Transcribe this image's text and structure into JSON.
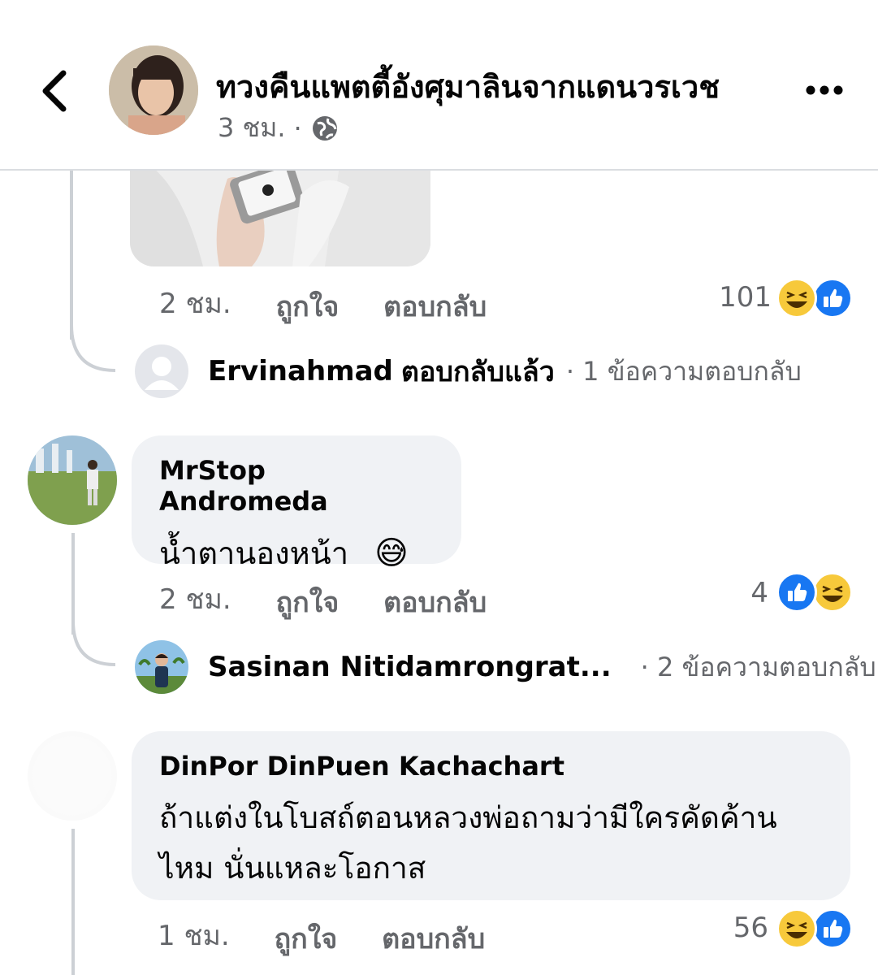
{
  "header": {
    "page_name": "ทวงคืนแพตตี้อังศุมาลินจากแดนวรเวช",
    "time": "3 ชม.",
    "dot": "·"
  },
  "comments": [
    {
      "time": "2 ชม.",
      "like_label": "ถูกใจ",
      "reply_label": "ตอบกลับ",
      "reaction_count": "101",
      "reactions": [
        "haha",
        "like"
      ]
    },
    {
      "author": "MrStop Andromeda",
      "text": "น้ำตานองหน้า",
      "emoji": "😅",
      "time": "2 ชม.",
      "like_label": "ถูกใจ",
      "reply_label": "ตอบกลับ",
      "reaction_count": "4",
      "reactions": [
        "like",
        "haha"
      ]
    },
    {
      "author": "DinPor DinPuen Kachachart",
      "text_line1": "ถ้าแต่งในโบสถ์ตอนหลวงพ่อถามว่ามีใครคัดค้าน",
      "text_line2": "ไหม นั่นแหละโอกาส",
      "time": "1 ชม.",
      "like_label": "ถูกใจ",
      "reply_label": "ตอบกลับ",
      "reaction_count": "56",
      "reactions": [
        "haha",
        "like"
      ]
    }
  ],
  "replies": [
    {
      "name": "Ervinahmad",
      "action": "ตอบกลับแล้ว",
      "info": "· 1 ข้อความตอบกลับ"
    },
    {
      "name": "Sasinan Nitidamrongrat...",
      "info": "· 2 ข้อความตอบกลับ"
    }
  ],
  "colors": {
    "haha": "#f7c93b",
    "like": "#1877f2",
    "bubble": "#f0f2f5",
    "secondary_text": "#65676b"
  }
}
